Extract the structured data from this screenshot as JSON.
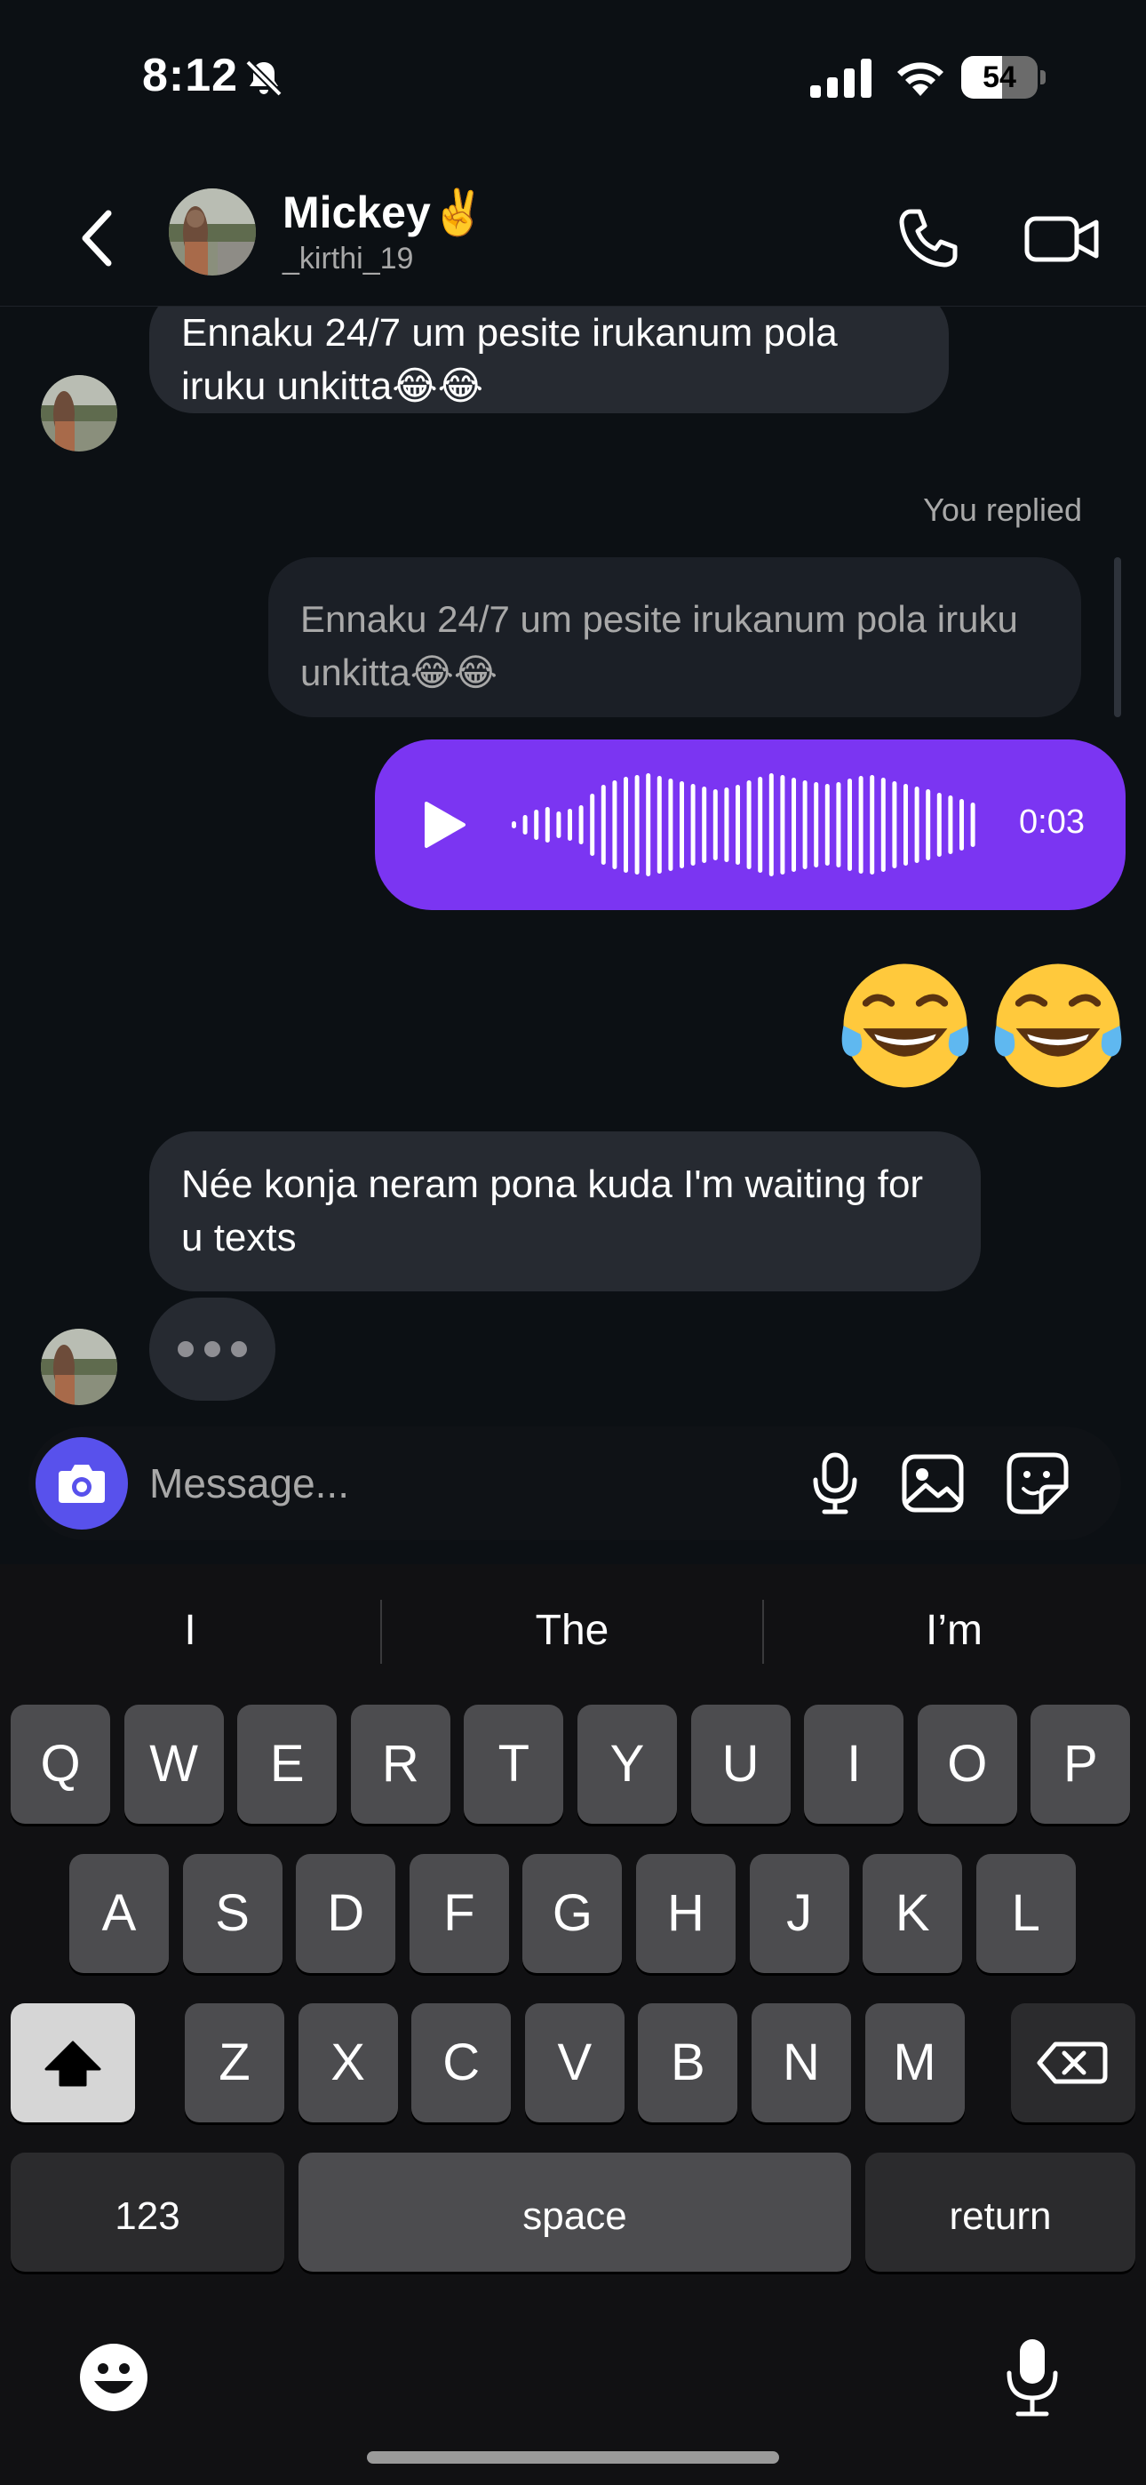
{
  "status_bar": {
    "time": "8:12",
    "battery": "54",
    "battery_level": 0.54
  },
  "header": {
    "name": "Mickey✌️",
    "handle": "_kirthi_19"
  },
  "messages": {
    "incoming_1": "Ennaku 24/7 um pesite irukanum pola iruku unkitta😂😂",
    "you_replied": "You replied",
    "quoted_text": "Ennaku 24/7 um pesite irukanum pola iruku unkitta😂😂",
    "voice_duration": "0:03",
    "emoji_reply": "😂😂",
    "incoming_2": "Née konja neram pona kuda I'm waiting for u texts"
  },
  "composer": {
    "placeholder": "Message..."
  },
  "keyboard": {
    "suggestions": [
      "I",
      "The",
      "I’m"
    ],
    "row1": [
      "Q",
      "W",
      "E",
      "R",
      "T",
      "Y",
      "U",
      "I",
      "O",
      "P"
    ],
    "row2": [
      "A",
      "S",
      "D",
      "F",
      "G",
      "H",
      "J",
      "K",
      "L"
    ],
    "row3": [
      "Z",
      "X",
      "C",
      "V",
      "B",
      "N",
      "M"
    ],
    "numbers_label": "123",
    "space_label": "space",
    "return_label": "return"
  },
  "colors": {
    "accent": "#7b35f2",
    "camera_button": "#5851ec",
    "background": "#0c1014",
    "bubble": "#262a31"
  }
}
